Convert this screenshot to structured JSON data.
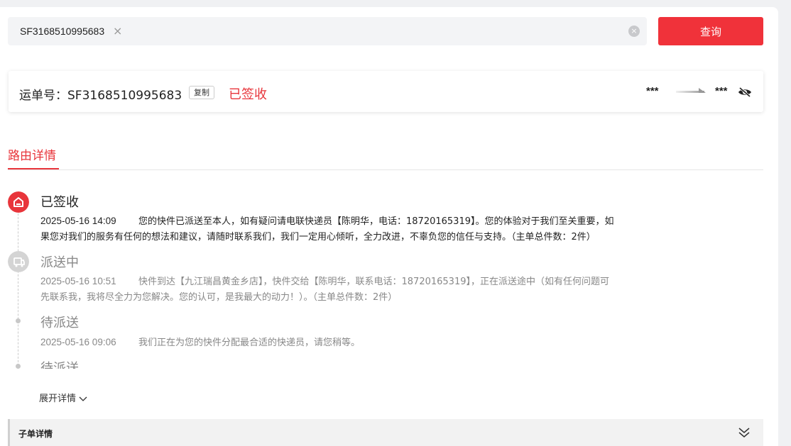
{
  "search": {
    "value": "SF3168510995683",
    "remove_icon": "×",
    "clear_icon": "×",
    "query_label": "查询"
  },
  "waybill": {
    "label": "运单号：SF3168510995683",
    "copy_label": "复制",
    "status": "已签收",
    "from": "***",
    "to": "***"
  },
  "tabs": {
    "route_label": "路由详情"
  },
  "timeline": [
    {
      "title": "已签收",
      "time": "2025-05-16 14:09",
      "desc_line1": "您的快件已派送至本人，如有疑问请电联快递员【陈明华，电话：18720165319】。您的体验对于我们至关重要，如",
      "desc_line2": "果您对我们的服务有任何的想法和建议，请随时联系我们，我们一定用心倾听，全力改进，不辜负您的信任与支持。（主单总件数：2件）"
    },
    {
      "title": "派送中",
      "time": "2025-05-16 10:51",
      "desc_line1": "快件到达【九江瑞昌黄金乡店】，快件交给【陈明华，联系电话：18720165319】，正在派送途中（如有任何问题可",
      "desc_line2": "先联系我，我将尽全力为您解决。您的认可，是我最大的动力！）。（主单总件数：2件）"
    },
    {
      "title": "待派送",
      "time": "2025-05-16 09:06",
      "desc_line1": "我们正在为您的快件分配最合适的快递员，请您稍等。"
    },
    {
      "title": "待派送"
    }
  ],
  "expand_label": "展开详情",
  "sub_order": {
    "title": "子单详情"
  },
  "colors": {
    "accent": "#f0323a",
    "status_red": "#e8353b"
  }
}
